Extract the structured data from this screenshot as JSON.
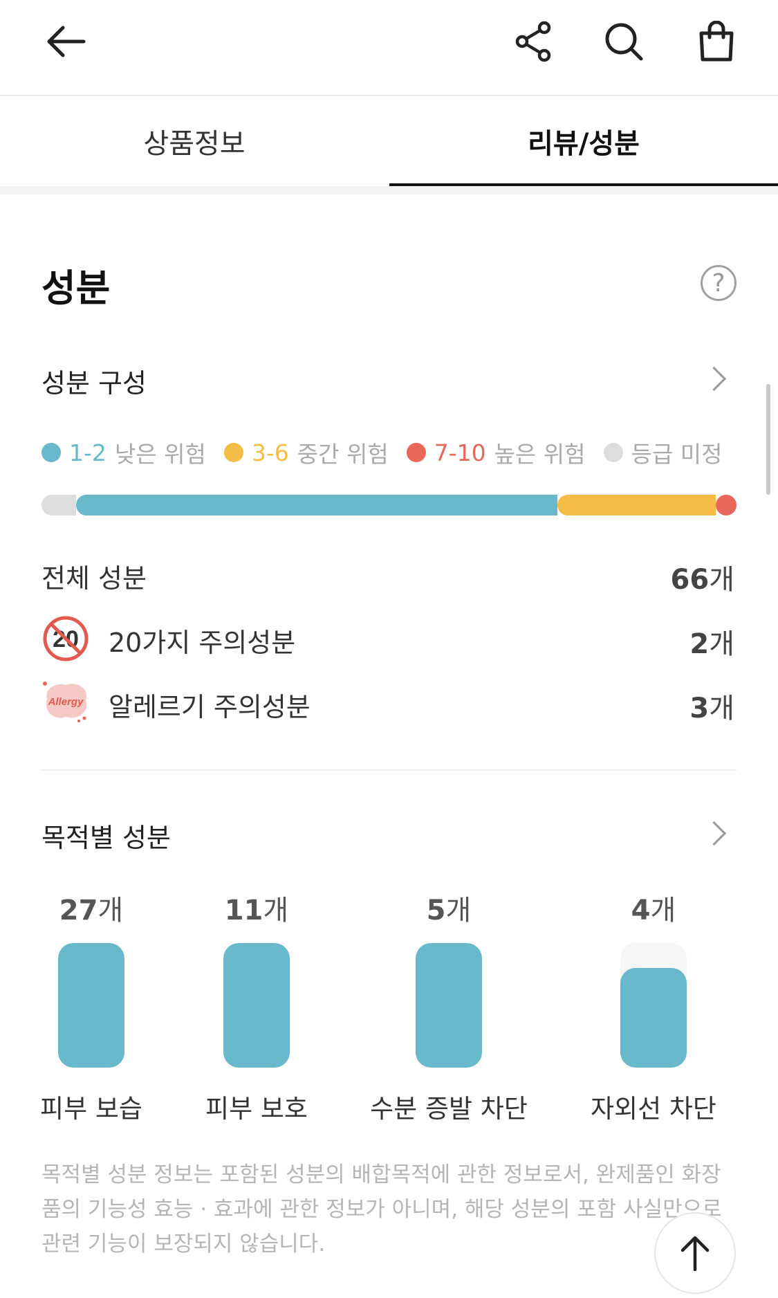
{
  "header": {
    "back_icon": "arrow-left-icon",
    "share_icon": "share-icon",
    "search_icon": "search-icon",
    "bag_icon": "shopping-bag-icon"
  },
  "tabs": [
    {
      "label": "상품정보",
      "active": false
    },
    {
      "label": "리뷰/성분",
      "active": true
    }
  ],
  "ingredients": {
    "title": "성분",
    "help_icon": "question-circle-icon",
    "help_symbol": "?",
    "composition": {
      "title": "성분 구성",
      "legend": [
        {
          "range": "1-2",
          "desc": "낮은 위험",
          "color": "#67b9cb"
        },
        {
          "range": "3-6",
          "desc": "중간 위험",
          "color": "#f5bd45"
        },
        {
          "range": "7-10",
          "desc": "높은 위험",
          "color": "#e9675a"
        },
        {
          "range": "",
          "desc": "등급 미정",
          "color": "#dddddd"
        }
      ],
      "bar_fractions": {
        "unrated": 0.05,
        "low": 0.7,
        "medium": 0.23,
        "high": 0.03
      }
    },
    "totals": {
      "total_label": "전체 성분",
      "total_value": "66",
      "unit": "개",
      "caution20_label": "20가지 주의성분",
      "caution20_badge": "20",
      "caution20_value": "2",
      "allergy_label": "알레르기 주의성분",
      "allergy_badge": "Allergy",
      "allergy_value": "3"
    },
    "purpose": {
      "title": "목적별 성분",
      "unit": "개",
      "items": [
        {
          "count": "27",
          "label": "피부 보습",
          "fill": 1.0
        },
        {
          "count": "11",
          "label": "피부 보호",
          "fill": 1.0
        },
        {
          "count": "5",
          "label": "수분 증발 차단",
          "fill": 1.0
        },
        {
          "count": "4",
          "label": "자외선 차단",
          "fill": 0.8
        }
      ],
      "notice": "목적별 성분 정보는 포함된 성분의 배합목적에 관한 정보로서, 완제품인 화장품의 기능성 효능 · 효과에 관한 정보가 아니며, 해당 성분의 포함 사실만으로 관련 기능이 보장되지 않습니다."
    }
  },
  "scroll_to_top_icon": "arrow-up-icon"
}
